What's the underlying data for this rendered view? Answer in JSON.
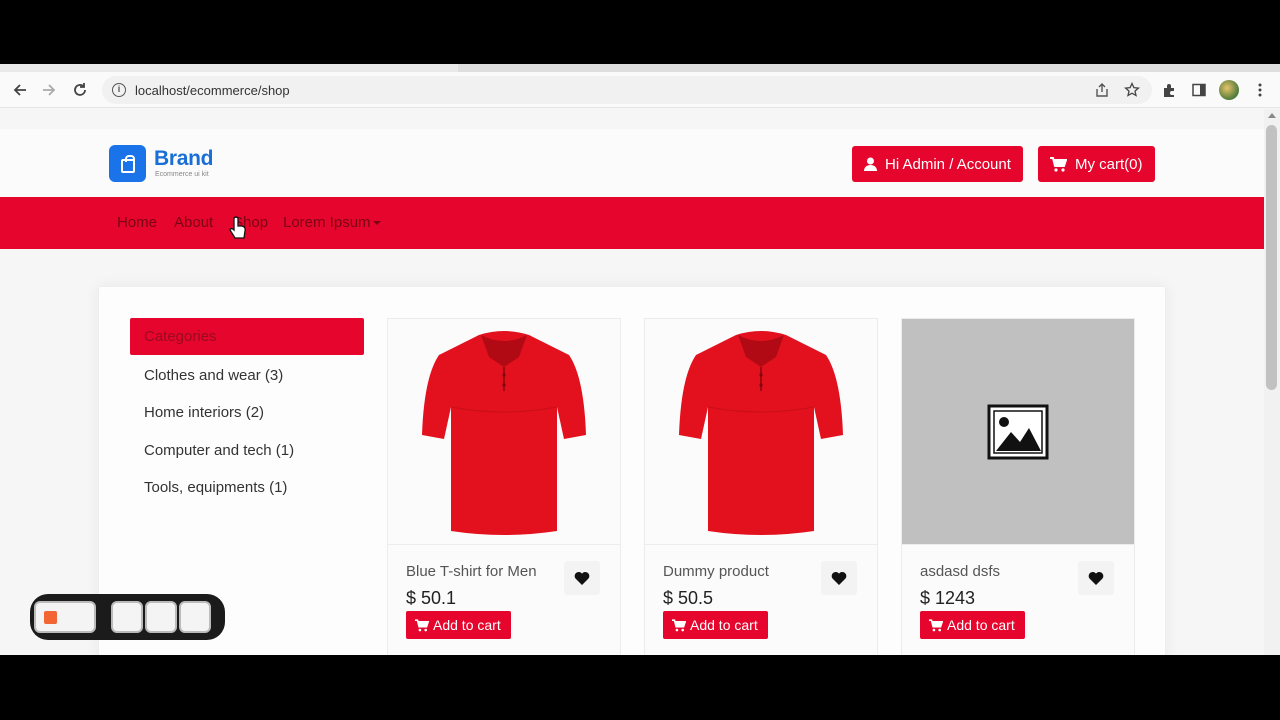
{
  "browser": {
    "url": "localhost/ecommerce/shop"
  },
  "brand": {
    "name": "Brand",
    "subtitle": "Ecommerce ui kit"
  },
  "header": {
    "account_label": "Hi Admin / Account",
    "cart_label": "My cart(0)"
  },
  "nav": {
    "items": [
      "Home",
      "About",
      "Shop",
      "Lorem Ipsum"
    ]
  },
  "categories": {
    "title": "Categories",
    "items": [
      "Clothes and wear (3)",
      "Home interiors (2)",
      "Computer and tech (1)",
      "Tools, equipments (1)"
    ]
  },
  "products": [
    {
      "name": "Blue T-shirt for Men",
      "price": "$ 50.1",
      "cart_label": "Add to cart",
      "image": "red-polo-shirt"
    },
    {
      "name": "Dummy product",
      "price": "$ 50.5",
      "cart_label": "Add to cart",
      "image": "red-polo-shirt"
    },
    {
      "name": "asdasd dsfs",
      "price": "$ 1243",
      "cart_label": "Add to cart",
      "image": "image-placeholder"
    }
  ],
  "colors": {
    "accent": "#e6052c",
    "brand": "#1a6fd6"
  }
}
